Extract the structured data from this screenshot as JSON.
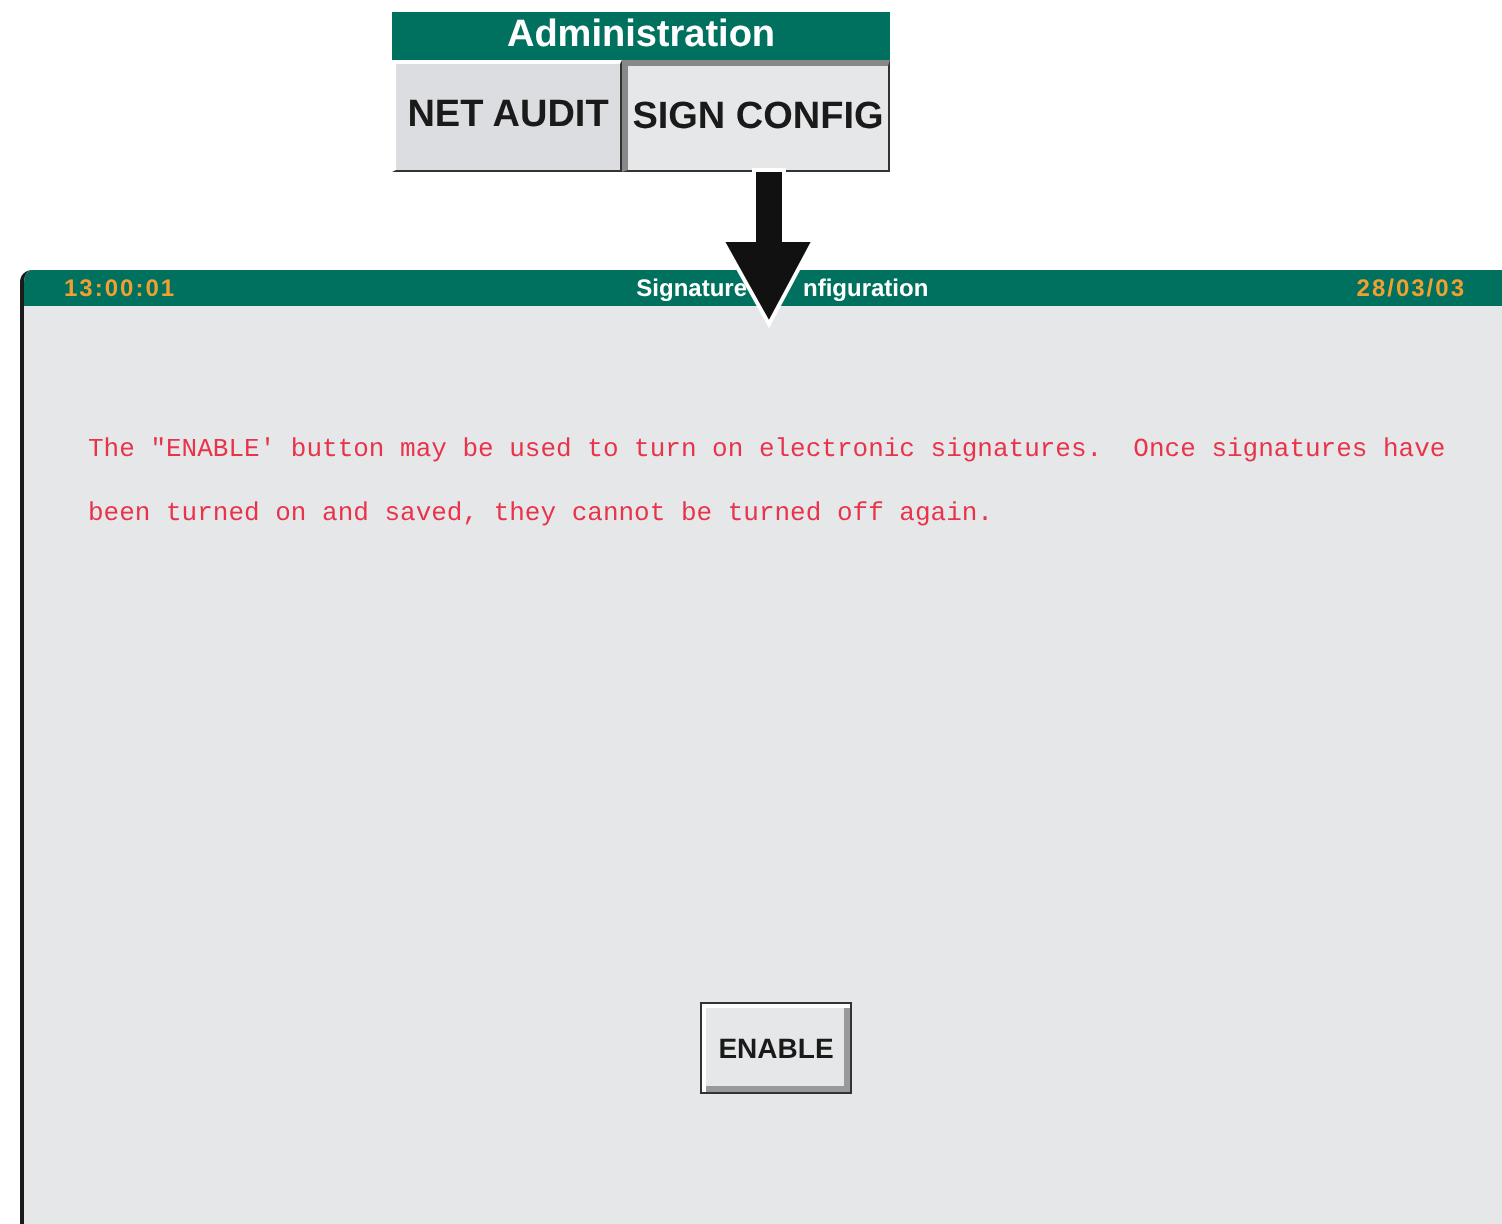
{
  "menu": {
    "title": "Administration",
    "buttons": [
      {
        "label": "NET AUDIT",
        "selected": false
      },
      {
        "label": "SIGN CONFIG",
        "selected": true
      }
    ]
  },
  "screen": {
    "time": "13:00:01",
    "title_parts": [
      "Signature",
      "nfiguration"
    ],
    "date": "28/03/03",
    "message": "The \"ENABLE' button may be used to turn on electronic signatures.  Once signatures have been turned on and saved, they cannot be turned off again.",
    "button": "ENABLE"
  }
}
